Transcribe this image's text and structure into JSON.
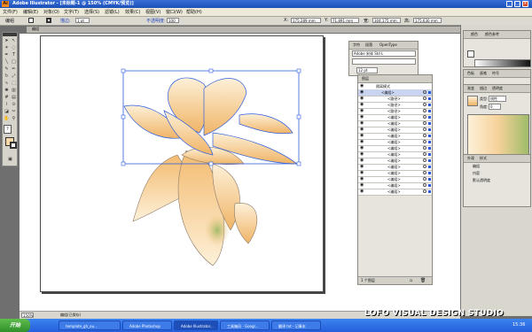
{
  "window": {
    "title": "Adobe Illustrator - [未标题-1 @ 150% (CMYK/预览)]"
  },
  "menubar": {
    "items": [
      "文件(F)",
      "编辑(E)",
      "对象(O)",
      "文字(T)",
      "选择(S)",
      "滤镜(L)",
      "效果(C)",
      "视图(V)",
      "窗口(W)",
      "帮助(H)"
    ]
  },
  "controlbar": {
    "mode": "编组",
    "stroke_label": "描边:",
    "stroke_value": "1 pt",
    "opacity_label": "不透明度:",
    "opacity_value": "100",
    "x_label": "X:",
    "x_value": "175.289 mm",
    "y_label": "Y:",
    "y_value": "71.891 mm",
    "w_label": "宽:",
    "w_value": "304.175 mm",
    "h_label": "高:",
    "h_value": "175.630 mm"
  },
  "document": {
    "tab": "编组"
  },
  "char_panel": {
    "tabs": [
      "字符",
      "段落",
      "OpenType"
    ],
    "font": "Adobe 宋体 Std L",
    "size": "12 pt"
  },
  "layers_panel": {
    "tab": "图层",
    "rows": [
      {
        "label": "隔离模式"
      },
      {
        "label": "<编组>"
      },
      {
        "label": "<路径>"
      },
      {
        "label": "<路径>"
      },
      {
        "label": "<路径>"
      },
      {
        "label": "<编组>"
      },
      {
        "label": "<编组>"
      },
      {
        "label": "<编组>"
      },
      {
        "label": "<编组>"
      },
      {
        "label": "<编组>"
      },
      {
        "label": "<编组>"
      },
      {
        "label": "<编组>"
      },
      {
        "label": "<编组>"
      },
      {
        "label": "<编组>"
      },
      {
        "label": "<编组>"
      },
      {
        "label": "<编组>"
      },
      {
        "label": "<编组>"
      },
      {
        "label": "<编组>"
      }
    ],
    "footer": "1 个图层"
  },
  "color_panel": {
    "tabs": [
      "颜色",
      "颜色参考"
    ]
  },
  "swatch_panel": {
    "tabs": [
      "色板",
      "画笔",
      "符号"
    ]
  },
  "gradient_panel": {
    "tabs": [
      "渐变",
      "描边",
      "透明度"
    ],
    "type_label": "类型:",
    "type_value": "线性",
    "angle_label": "角度:",
    "angle_value": "0"
  },
  "appearance_panel": {
    "tabs": [
      "外观",
      "样式"
    ],
    "item": "编组",
    "row1": "内容",
    "row2": "默认透明度"
  },
  "statusbar": {
    "zoom": "150%",
    "info": "编组(已保存)"
  },
  "taskbar": {
    "start": "开始",
    "tasks": [
      "template_gh_ou...",
      "Adobe Photoshop",
      "Adobe Illustrator...",
      "工具箱风 - Googl...",
      "翻译 txt - 记事本"
    ],
    "clock": "15:36"
  },
  "watermark": "LOFO VISUAL DESIGN STUDIO",
  "colors": {
    "accent": "#2f5fe0",
    "petal_light": "#fbe8c8",
    "petal_dark": "#f0b466",
    "stem_green": "#9fbc6a"
  }
}
